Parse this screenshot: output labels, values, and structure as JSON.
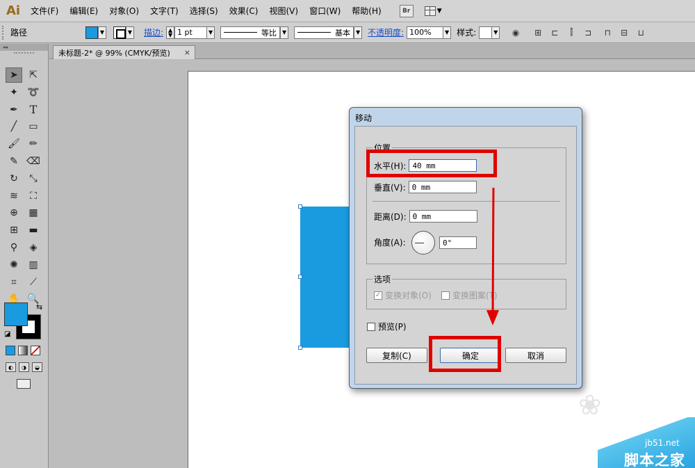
{
  "app": {
    "logo": "Ai",
    "menu": [
      "文件(F)",
      "编辑(E)",
      "对象(O)",
      "文字(T)",
      "选择(S)",
      "效果(C)",
      "视图(V)",
      "窗口(W)",
      "帮助(H)"
    ],
    "bridge_label": "Br"
  },
  "control_bar": {
    "object_type": "路径",
    "stroke_label": "描边:",
    "stroke_weight": "1 pt",
    "profile_label": "等比",
    "brush_label": "基本",
    "opacity_label": "不透明度:",
    "opacity_value": "100%",
    "style_label": "样式:"
  },
  "toolbar": {
    "collapse_label": "◂◂"
  },
  "document": {
    "tab_title": "未标题-2* @ 99% (CMYK/预览)",
    "close_glyph": "×"
  },
  "dialog": {
    "title": "移动",
    "position_group": "位置",
    "horizontal_label": "水平(H):",
    "horizontal_value": "40 mm",
    "vertical_label": "垂直(V):",
    "vertical_value": "0 mm",
    "distance_label": "距离(D):",
    "distance_value": "0 mm",
    "angle_label": "角度(A):",
    "angle_value": "0°",
    "options_group": "选项",
    "transform_objects": "变换对象(O)",
    "transform_patterns": "变换图案(T)",
    "preview_label": "预览(P)",
    "copy_button": "复制(C)",
    "ok_button": "确定",
    "cancel_button": "取消"
  },
  "watermark": {
    "url": "jb51.net",
    "text": "脚本之家"
  },
  "colors": {
    "fill": "#1a9be0",
    "annotation_red": "#e00000",
    "dialog_frame": "#c1d5ea"
  }
}
